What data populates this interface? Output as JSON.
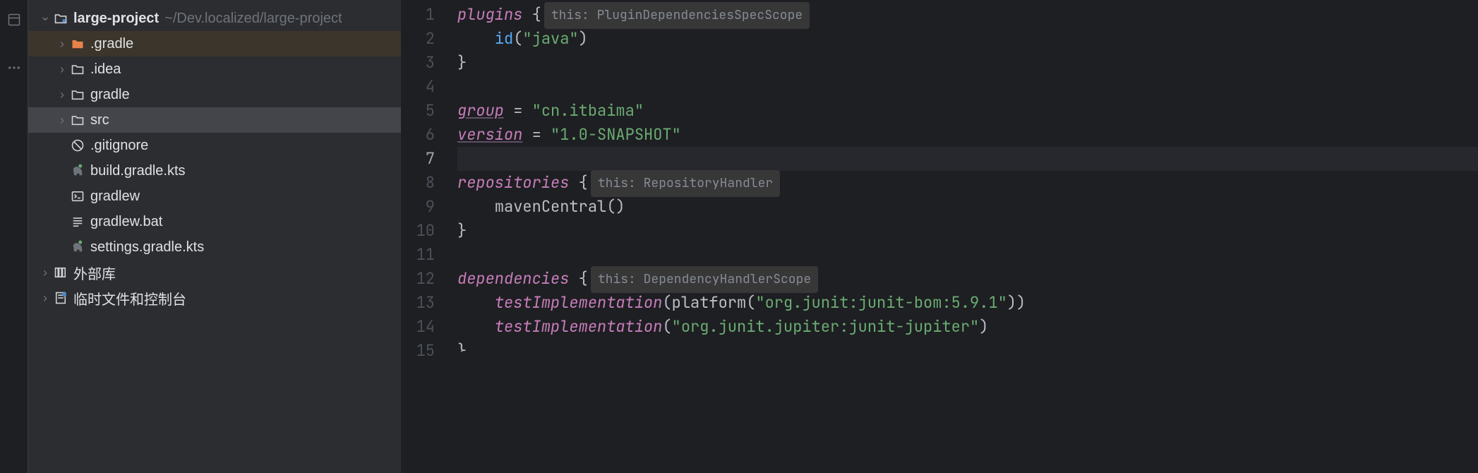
{
  "project": {
    "root_name": "large-project",
    "root_path": "~/Dev.localized/large-project",
    "tree": [
      {
        "label": ".gradle",
        "type": "folder-orange",
        "indent": 2,
        "chevron": "right",
        "highlighted": true
      },
      {
        "label": ".idea",
        "type": "folder",
        "indent": 2,
        "chevron": "right"
      },
      {
        "label": "gradle",
        "type": "folder",
        "indent": 2,
        "chevron": "right"
      },
      {
        "label": "src",
        "type": "folder",
        "indent": 2,
        "chevron": "right",
        "selected": true
      },
      {
        "label": ".gitignore",
        "type": "gitignore",
        "indent": 2
      },
      {
        "label": "build.gradle.kts",
        "type": "gradle-file",
        "indent": 2
      },
      {
        "label": "gradlew",
        "type": "terminal-file",
        "indent": 2
      },
      {
        "label": "gradlew.bat",
        "type": "text-file",
        "indent": 2
      },
      {
        "label": "settings.gradle.kts",
        "type": "gradle-file",
        "indent": 2
      }
    ],
    "external_libs": "外部库",
    "scratches": "临时文件和控制台"
  },
  "editor": {
    "lines": {
      "1": {
        "tokens": [
          {
            "t": "plugins ",
            "c": "kw-block"
          },
          {
            "t": "{",
            "c": "kw-brace"
          },
          {
            "hint": "this: PluginDependenciesSpecScope"
          }
        ]
      },
      "2": {
        "tokens": [
          {
            "t": "    "
          },
          {
            "t": "id",
            "c": "kw-call"
          },
          {
            "t": "(",
            "c": "kw-brace"
          },
          {
            "t": "\"java\"",
            "c": "kw-string"
          },
          {
            "t": ")",
            "c": "kw-brace"
          }
        ]
      },
      "3": {
        "tokens": [
          {
            "t": "}",
            "c": "kw-brace"
          }
        ]
      },
      "4": {
        "tokens": []
      },
      "5": {
        "tokens": [
          {
            "t": "group",
            "c": "kw-prop"
          },
          {
            "t": " = ",
            "c": "kw-op"
          },
          {
            "t": "\"cn.itbaima\"",
            "c": "kw-string"
          }
        ]
      },
      "6": {
        "tokens": [
          {
            "t": "version",
            "c": "kw-prop"
          },
          {
            "t": " = ",
            "c": "kw-op"
          },
          {
            "t": "\"1.0-SNAPSHOT\"",
            "c": "kw-string"
          }
        ]
      },
      "7": {
        "tokens": [],
        "current": true
      },
      "8": {
        "tokens": [
          {
            "t": "repositories ",
            "c": "kw-block"
          },
          {
            "t": "{",
            "c": "kw-brace"
          },
          {
            "hint": "this: RepositoryHandler"
          }
        ]
      },
      "9": {
        "tokens": [
          {
            "t": "    "
          },
          {
            "t": "mavenCentral",
            "c": "kw-ident"
          },
          {
            "t": "()",
            "c": "kw-brace"
          }
        ]
      },
      "10": {
        "tokens": [
          {
            "t": "}",
            "c": "kw-brace"
          }
        ]
      },
      "11": {
        "tokens": []
      },
      "12": {
        "tokens": [
          {
            "t": "dependencies ",
            "c": "kw-block"
          },
          {
            "t": "{",
            "c": "kw-brace"
          },
          {
            "hint": "this: DependencyHandlerScope"
          }
        ]
      },
      "13": {
        "tokens": [
          {
            "t": "    "
          },
          {
            "t": "testImplementation",
            "c": "kw-func"
          },
          {
            "t": "(",
            "c": "kw-brace"
          },
          {
            "t": "platform",
            "c": "kw-ident"
          },
          {
            "t": "(",
            "c": "kw-brace"
          },
          {
            "t": "\"org.junit:junit-bom:5.9.1\"",
            "c": "kw-string"
          },
          {
            "t": "))",
            "c": "kw-brace"
          }
        ]
      },
      "14": {
        "tokens": [
          {
            "t": "    "
          },
          {
            "t": "testImplementation",
            "c": "kw-func"
          },
          {
            "t": "(",
            "c": "kw-brace"
          },
          {
            "t": "\"org.junit.jupiter:junit-jupiter\"",
            "c": "kw-string"
          },
          {
            "t": ")",
            "c": "kw-brace"
          }
        ]
      },
      "15": {
        "tokens": [
          {
            "t": "}",
            "c": "kw-brace"
          }
        ],
        "partial": true
      }
    },
    "line_count": 15
  }
}
